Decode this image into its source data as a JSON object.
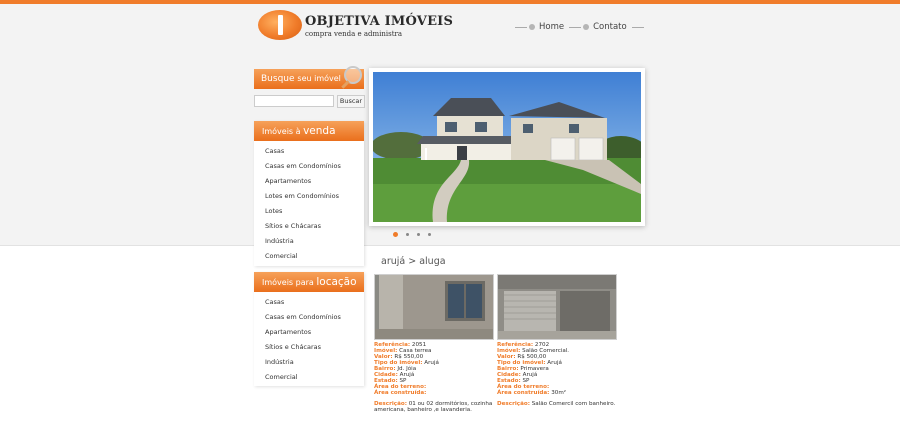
{
  "brand": {
    "name": "OBJETIVA IMÓVEIS",
    "tagline": "compra venda e administra",
    "accent_color": "#f07c2a"
  },
  "nav": {
    "items": [
      {
        "label": "Home"
      },
      {
        "label": "Contato"
      }
    ]
  },
  "search": {
    "heading_main": "Busque",
    "heading_rest": "seu imóvel",
    "input_value": "",
    "button_label": "Buscar"
  },
  "sale_menu": {
    "heading_pre": "Imóveis à",
    "heading_big": "venda",
    "items": [
      "Casas",
      "Casas em Condomínios",
      "Apartamentos",
      "Lotes em Condomínios",
      "Lotes",
      "Sítios e Chácaras",
      "Indústria",
      "Comercial"
    ]
  },
  "rent_menu": {
    "heading_pre": "Imóveis para",
    "heading_big": "locação",
    "items": [
      "Casas",
      "Casas em Condomínios",
      "Apartamentos",
      "Sítios e Chácaras",
      "Indústria",
      "Comercial"
    ]
  },
  "slider": {
    "slide_count": 4,
    "active_index": 0
  },
  "listing": {
    "breadcrumb": "arujá > aluga",
    "properties": [
      {
        "fields": [
          {
            "label": "Referência:",
            "value": "2051"
          },
          {
            "label": "Imóvel:",
            "value": "Casa terrea"
          },
          {
            "label": "Valor:",
            "value": "R$ 550,00"
          },
          {
            "label": "Tipo do imóvel:",
            "value": "Arujá"
          },
          {
            "label": "Bairro:",
            "value": "Jd. Jóia"
          },
          {
            "label": "Cidade:",
            "value": "Arujá"
          },
          {
            "label": "Estado:",
            "value": "SP"
          },
          {
            "label": "Área do terreno:",
            "value": ""
          },
          {
            "label": "Área construída:",
            "value": ""
          }
        ],
        "description_label": "Descrição:",
        "description": "01 ou 02 dormitórios, cozinha americana, banheiro ,e lavanderia."
      },
      {
        "fields": [
          {
            "label": "Referência:",
            "value": "2702"
          },
          {
            "label": "Imóvel:",
            "value": "Salão Comercial."
          },
          {
            "label": "Valor:",
            "value": "R$ 500,00"
          },
          {
            "label": "Tipo do imóvel:",
            "value": "Arujá"
          },
          {
            "label": "Bairro:",
            "value": "Primavera"
          },
          {
            "label": "Cidade:",
            "value": "Arujá"
          },
          {
            "label": "Estado:",
            "value": "SP"
          },
          {
            "label": "Área do terreno:",
            "value": ""
          },
          {
            "label": "Área construída:",
            "value": "30m²"
          }
        ],
        "description_label": "Descrição:",
        "description": "Salão Comercil com banheiro."
      }
    ]
  }
}
